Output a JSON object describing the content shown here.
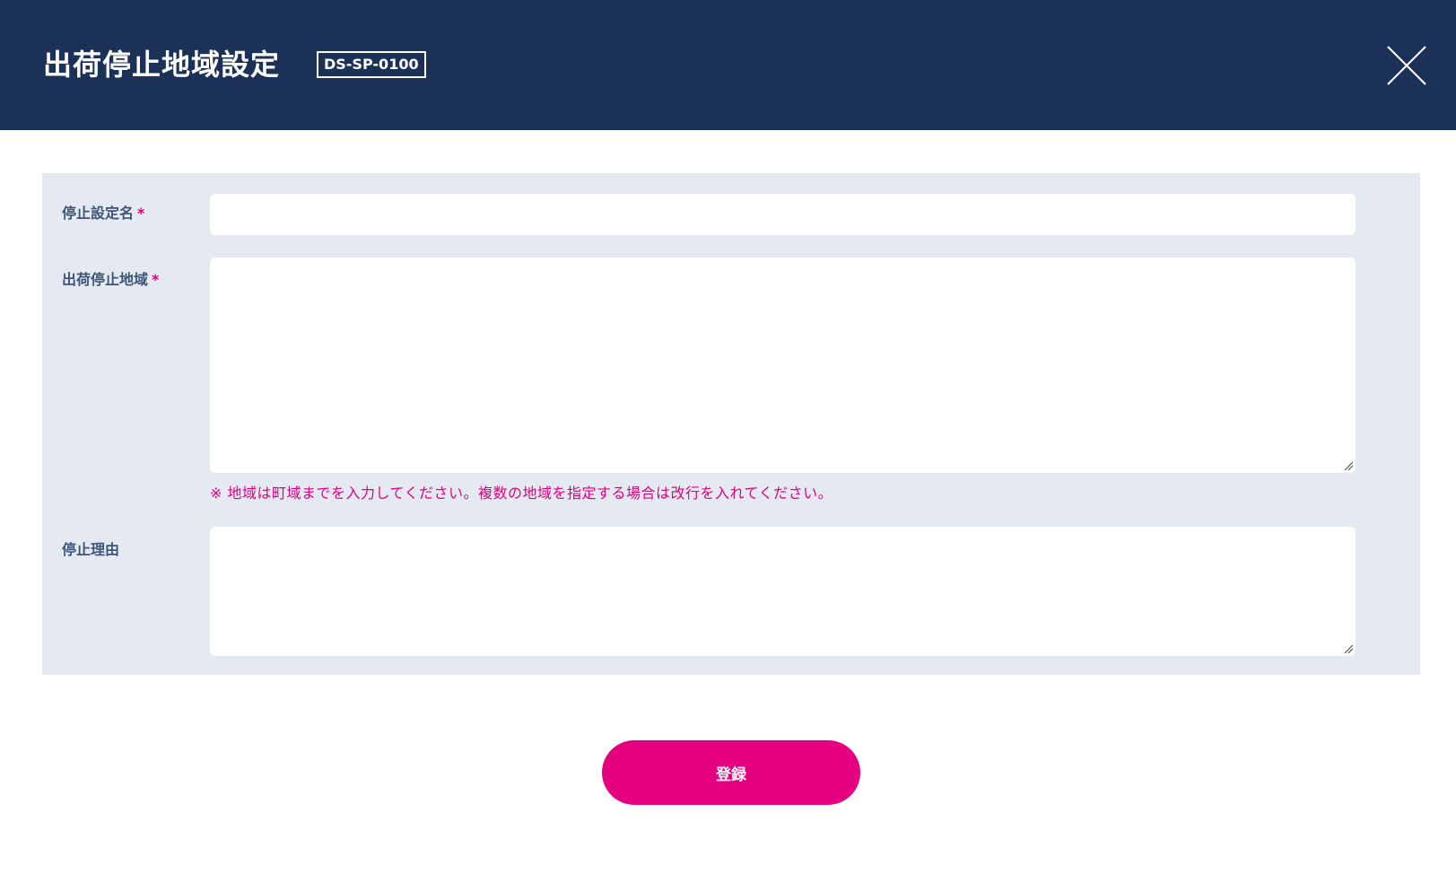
{
  "header": {
    "title": "出荷停止地域設定",
    "screen_code": "DS-SP-0100",
    "close_icon": "close-icon"
  },
  "form": {
    "stop_setting_name": {
      "label": "停止設定名",
      "required_mark": "*",
      "value": "",
      "placeholder": ""
    },
    "stop_region": {
      "label": "出荷停止地域",
      "required_mark": "*",
      "value": "",
      "placeholder": "",
      "hint": "※ 地域は町域までを入力してください。複数の地域を指定する場合は改行を入れてください。"
    },
    "stop_reason": {
      "label": "停止理由",
      "value": "",
      "placeholder": ""
    }
  },
  "actions": {
    "submit_label": "登録"
  },
  "colors": {
    "header_bg": "#1b3157",
    "panel_bg": "#e4e9f2",
    "accent": "#e4007f",
    "label": "#3e5576"
  }
}
